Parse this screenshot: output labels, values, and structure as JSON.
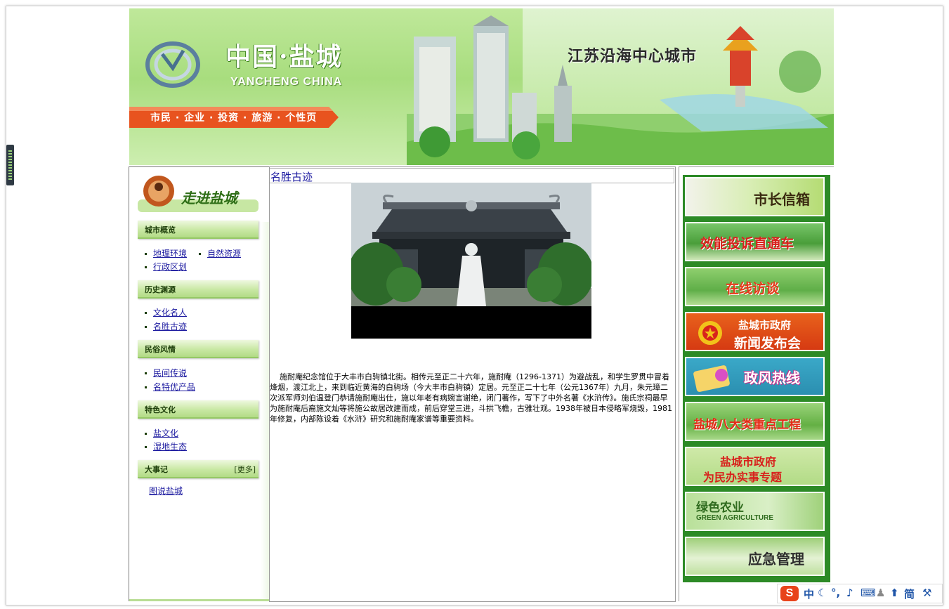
{
  "banner": {
    "logo_cn": "中国·盐城",
    "logo_en": "YANCHENG CHINA",
    "slogan": "江苏沿海中心城市",
    "nav_ribbon": "市民 · 企业 · 投资 · 旅游 · 个性页"
  },
  "sidebar": {
    "header_image_label": "走进盐城",
    "sections": [
      {
        "title": "城市概览",
        "items": [
          "地理环境",
          "自然资源",
          "行政区划"
        ]
      },
      {
        "title": "历史渊源",
        "items": [
          "文化名人",
          "名胜古迹"
        ]
      },
      {
        "title": "民俗风情",
        "items": [
          "民间传说",
          "名特优产品"
        ]
      },
      {
        "title": "特色文化",
        "items": [
          "盐文化",
          "湿地生态"
        ]
      },
      {
        "title": "大事记",
        "more": "[更多]",
        "items": [
          "图说盐城"
        ]
      }
    ]
  },
  "main": {
    "title": "名胜古迹",
    "article": "施耐庵纪念馆位于大丰市白驹镇北街。相传元至正二十六年，施耐庵（1296-1371）为避战乱，和学生罗贯中冒着烽烟，渡江北上，来到临近黄海的白驹场（今大丰市白驹镇）定居。元至正二十七年（公元1367年）九月，朱元璋二次派军师刘伯温登门恭请施耐庵出仕，施以年老有病婉言谢绝，闭门著作，写下了中外名著《水浒传》。施氏宗祠最早为施耐庵后裔施文灿等将施公故居改建而成，前后穿堂三进，斗拱飞檐，古雅壮观。1938年被日本侵略军烧毁，1981年修复，内部陈设着《水浒》研究和施耐庵家谱等重要资料。"
  },
  "right_links": [
    {
      "label": "市长信箱"
    },
    {
      "label": "效能投诉直通车"
    },
    {
      "label": "在线访谈"
    },
    {
      "label": "盐城市政府",
      "label2": "新闻发布会"
    },
    {
      "label": "政风热线"
    },
    {
      "label": "盐城八大类重点工程"
    },
    {
      "label": "盐城市政府",
      "label2": "为民办实事专题"
    },
    {
      "label": "绿色农业",
      "label2": "GREEN AGRICULTURE"
    },
    {
      "label": "应急管理"
    }
  ],
  "tray": {
    "s_icon": "S",
    "lang": "中",
    "simp": "简"
  },
  "colors": {
    "link": "#1d1ba0",
    "section_green": "#b2db86",
    "right_panel": "#2c8a26",
    "ribbon": "#e8531f"
  }
}
